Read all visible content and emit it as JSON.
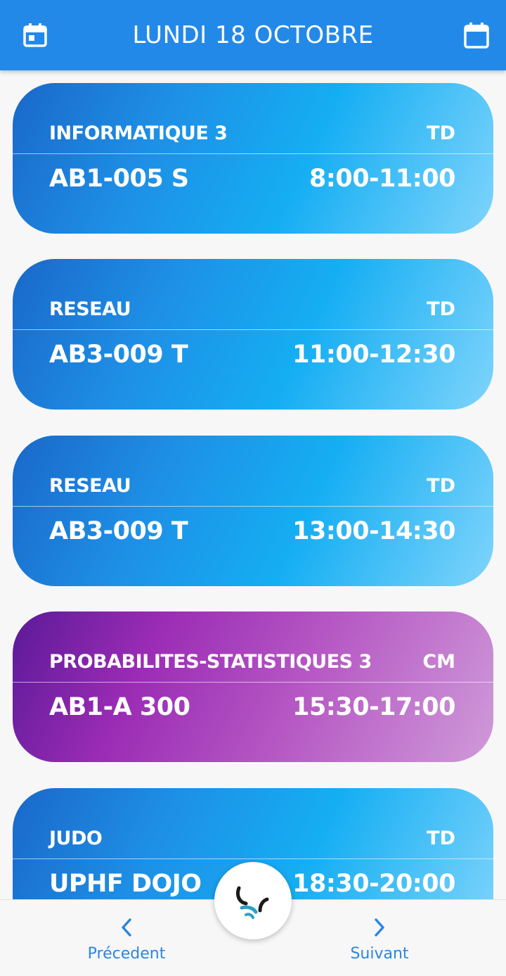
{
  "header": {
    "title": "LUNDI 18 OCTOBRE",
    "left_icon": "calendar-today-icon",
    "right_icon": "calendar-icon",
    "color": "#2389e8"
  },
  "courses": [
    {
      "name": "INFORMATIQUE 3",
      "type": "TD",
      "room": "AB1-005 S",
      "time": "8:00-11:00",
      "theme": "blue"
    },
    {
      "name": "RESEAU",
      "type": "TD",
      "room": "AB3-009 T",
      "time": "11:00-12:30",
      "theme": "blue"
    },
    {
      "name": "RESEAU",
      "type": "TD",
      "room": "AB3-009 T",
      "time": "13:00-14:30",
      "theme": "blue"
    },
    {
      "name": "PROBABILITES-STATISTIQUES 3",
      "type": "CM",
      "room": "AB1-A 300",
      "time": "15:30-17:00",
      "theme": "purple"
    },
    {
      "name": "JUDO",
      "type": "TD",
      "room": "UPHF DOJO",
      "time": "18:30-20:00",
      "theme": "blue"
    }
  ],
  "footer": {
    "prev_label": "Précedent",
    "next_label": "Suivant",
    "prev_icon": "chevron-left-icon",
    "next_icon": "chevron-right-icon",
    "fab_icon": "app-logo-icon",
    "accent": "#2b86e0"
  }
}
